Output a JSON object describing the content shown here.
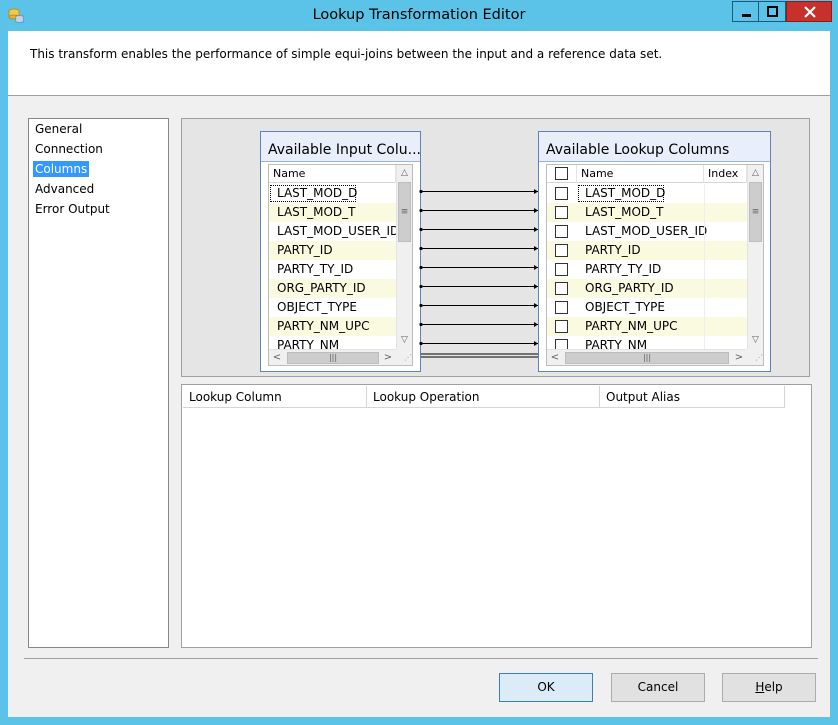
{
  "window": {
    "title": "Lookup Transformation Editor"
  },
  "description": "This transform enables the performance of simple equi-joins between the input and a reference data set.",
  "nav": {
    "items": [
      {
        "label": "General"
      },
      {
        "label": "Connection"
      },
      {
        "label": "Columns",
        "selected": true
      },
      {
        "label": "Advanced"
      },
      {
        "label": "Error Output"
      }
    ]
  },
  "input_table": {
    "title": "Available Input Colu...",
    "column_header": "Name",
    "rows": [
      "LAST_MOD_D",
      "LAST_MOD_T",
      "LAST_MOD_USER_ID",
      "PARTY_ID",
      "PARTY_TY_ID",
      "ORG_PARTY_ID",
      "OBJECT_TYPE",
      "PARTY_NM_UPC",
      "PARTY_NM"
    ]
  },
  "lookup_table": {
    "title": "Available Lookup Columns",
    "column_header_name": "Name",
    "column_header_index": "Index",
    "rows": [
      "LAST_MOD_D",
      "LAST_MOD_T",
      "LAST_MOD_USER_ID",
      "PARTY_ID",
      "PARTY_TY_ID",
      "ORG_PARTY_ID",
      "OBJECT_TYPE",
      "PARTY_NM_UPC",
      "PARTY_NM"
    ]
  },
  "output_grid": {
    "headers": [
      "Lookup Column",
      "Lookup Operation",
      "Output Alias"
    ]
  },
  "buttons": {
    "ok": "OK",
    "cancel": "Cancel",
    "help_prefix": "H",
    "help_rest": "elp"
  },
  "icons": {
    "app": "lookup-transform-icon",
    "minimize": "minimize-icon",
    "maximize": "maximize-icon",
    "close": "close-icon"
  },
  "colors": {
    "title_bar": "#5bc3e8",
    "selected_nav": "#3399ff",
    "alt_row": "#fafae1",
    "close_button": "#c7302b"
  }
}
